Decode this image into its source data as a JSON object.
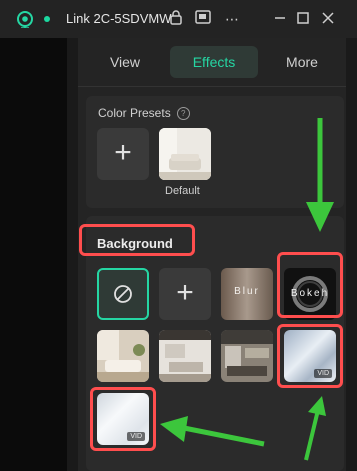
{
  "window": {
    "title": "Link 2C-5SDVMW",
    "buttons": [
      "menu-more",
      "minimize",
      "maximize",
      "close"
    ]
  },
  "tabs": [
    {
      "label": "View",
      "active": false
    },
    {
      "label": "Effects",
      "active": true
    },
    {
      "label": "More",
      "active": false
    }
  ],
  "color_presets": {
    "title": "Color Presets",
    "default_label": "Default"
  },
  "background": {
    "title": "Background",
    "tiles": [
      {
        "kind": "none"
      },
      {
        "kind": "add"
      },
      {
        "kind": "blur",
        "label": "Blur"
      },
      {
        "kind": "bokeh",
        "label": "Bokeh"
      },
      {
        "kind": "image",
        "scene": "living-room"
      },
      {
        "kind": "image",
        "scene": "office"
      },
      {
        "kind": "image",
        "scene": "kitchen"
      },
      {
        "kind": "video",
        "badge": "VID"
      },
      {
        "kind": "video",
        "badge": "VID"
      }
    ]
  },
  "colors": {
    "accent": "#25d6a3",
    "highlight": "#ff4e4e",
    "arrow": "#3cc63c"
  }
}
